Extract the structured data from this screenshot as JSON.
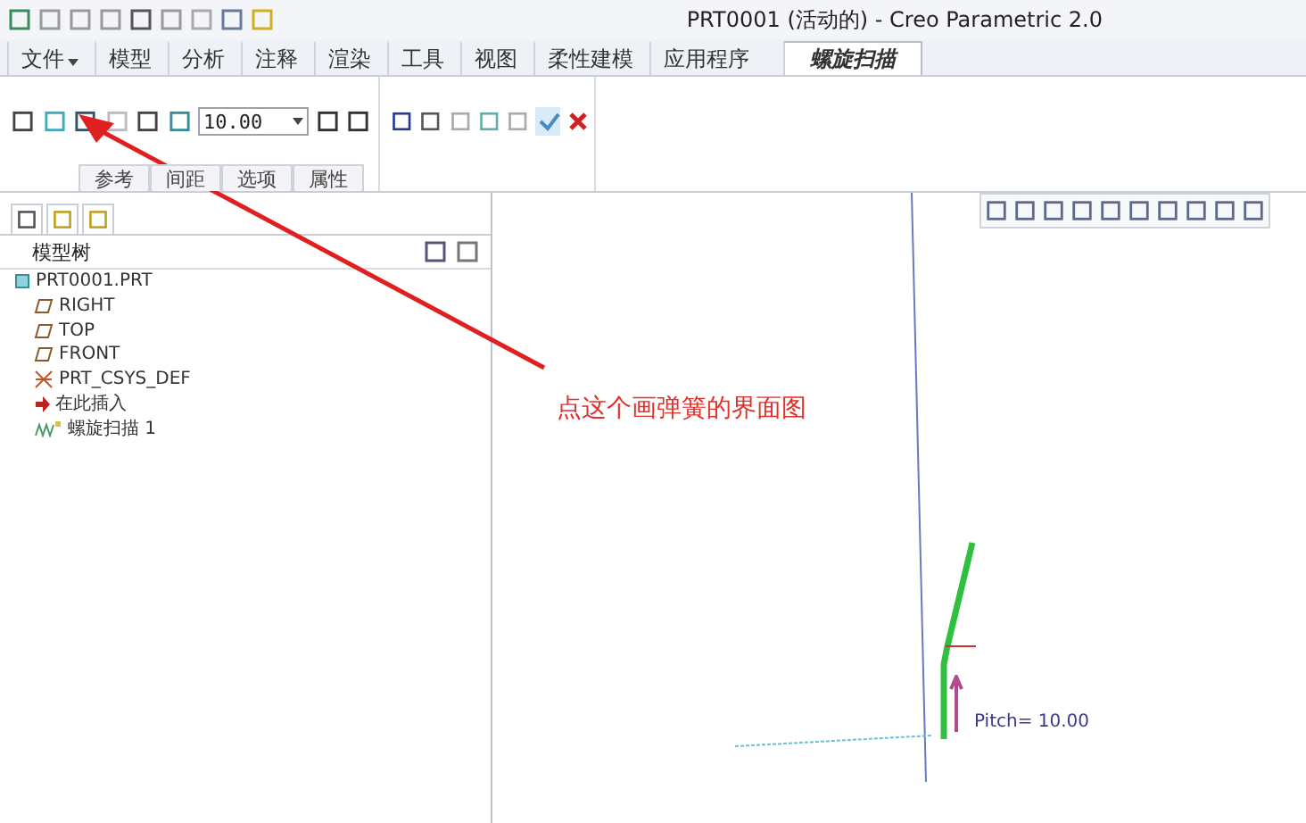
{
  "window": {
    "title": "PRT0001 (活动的) - Creo Parametric 2.0"
  },
  "menu_tabs": [
    {
      "label": "文件",
      "selected": false,
      "kind": "file"
    },
    {
      "label": "模型",
      "selected": false,
      "kind": "tab"
    },
    {
      "label": "分析",
      "selected": false,
      "kind": "tab"
    },
    {
      "label": "注释",
      "selected": false,
      "kind": "tab"
    },
    {
      "label": "渲染",
      "selected": false,
      "kind": "tab"
    },
    {
      "label": "工具",
      "selected": false,
      "kind": "tab"
    },
    {
      "label": "视图",
      "selected": false,
      "kind": "tab"
    },
    {
      "label": "柔性建模",
      "selected": false,
      "kind": "tab"
    },
    {
      "label": "应用程序",
      "selected": false,
      "kind": "tab"
    },
    {
      "label": "螺旋扫描",
      "selected": true,
      "kind": "tab"
    }
  ],
  "ribbon": {
    "pitch_value": "10.00",
    "sub_tabs": [
      "参考",
      "间距",
      "选项",
      "属性"
    ]
  },
  "model_tree": {
    "title": "模型树",
    "items": [
      {
        "label": "PRT0001.PRT",
        "kind": "part",
        "children": [
          {
            "label": "RIGHT",
            "kind": "plane"
          },
          {
            "label": "TOP",
            "kind": "plane"
          },
          {
            "label": "FRONT",
            "kind": "plane"
          },
          {
            "label": "PRT_CSYS_DEF",
            "kind": "csys"
          },
          {
            "label": "在此插入",
            "kind": "insert"
          },
          {
            "label": "螺旋扫描 1",
            "kind": "feature"
          }
        ]
      }
    ]
  },
  "graphics": {
    "pitch_label": "Pitch= 10.00"
  },
  "annotation": {
    "text": "点这个画弹簧的界面图"
  }
}
